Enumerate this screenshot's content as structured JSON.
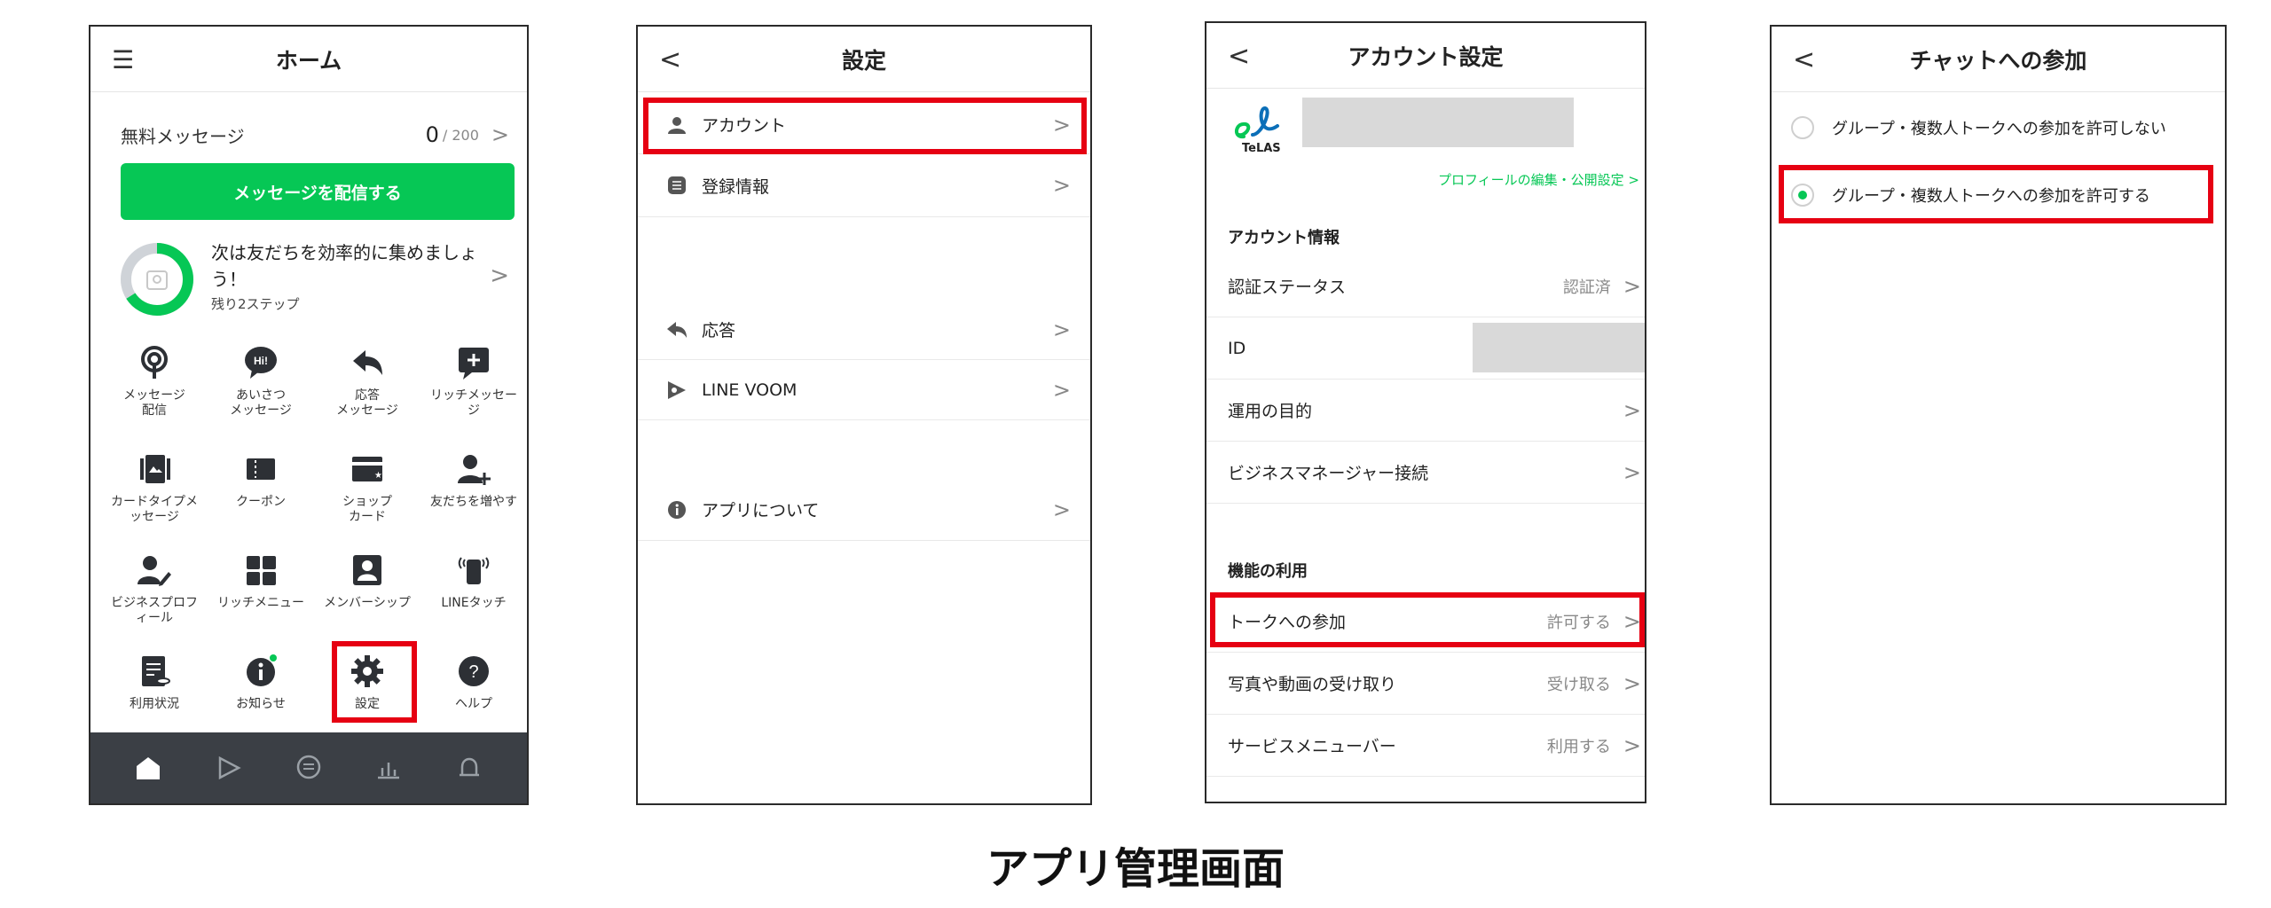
{
  "screens": {
    "home": {
      "title": "ホーム",
      "free_label": "無料メッセージ",
      "free_count": "0",
      "free_total": "/ 200",
      "broadcast_button": "メッセージを配信する",
      "progress_text": "次は友だちを効率的に集めましょう！",
      "progress_sub": "残り2ステップ",
      "tiles": [
        {
          "label": "メッセージ\n配信",
          "icon": "broadcast-icon"
        },
        {
          "label": "あいさつ\nメッセージ",
          "icon": "greeting-icon"
        },
        {
          "label": "応答\nメッセージ",
          "icon": "reply-icon"
        },
        {
          "label": "リッチメッセー\nジ",
          "icon": "rich-message-icon"
        },
        {
          "label": "カードタイプメ\nッセージ",
          "icon": "card-message-icon"
        },
        {
          "label": "クーポン",
          "icon": "coupon-icon"
        },
        {
          "label": "ショップ\nカード",
          "icon": "shop-card-icon"
        },
        {
          "label": "友だちを増やす",
          "icon": "add-friend-icon"
        },
        {
          "label": "ビジネスプロフ\nィール",
          "icon": "business-profile-icon"
        },
        {
          "label": "リッチメニュー",
          "icon": "rich-menu-icon"
        },
        {
          "label": "メンバーシップ",
          "icon": "membership-icon"
        },
        {
          "label": "LINEタッチ",
          "icon": "line-touch-icon"
        },
        {
          "label": "利用状況",
          "icon": "usage-icon"
        },
        {
          "label": "お知らせ",
          "icon": "info-icon"
        },
        {
          "label": "設定",
          "icon": "gear-icon"
        },
        {
          "label": "ヘルプ",
          "icon": "help-icon"
        }
      ]
    },
    "settings": {
      "title": "設定",
      "items": [
        {
          "label": "アカウント",
          "icon": "person-icon"
        },
        {
          "label": "登録情報",
          "icon": "registration-icon"
        },
        {
          "label": "応答",
          "icon": "reply-icon"
        },
        {
          "label": "LINE VOOM",
          "icon": "voom-icon"
        },
        {
          "label": "アプリについて",
          "icon": "info-icon"
        }
      ]
    },
    "account": {
      "title": "アカウント設定",
      "logo_text": "TeLAS",
      "profile_link": "プロフィールの編集・公開設定 >",
      "section_info": "アカウント情報",
      "section_features": "機能の利用",
      "rows": [
        {
          "label": "認証ステータス",
          "value": "認証済"
        },
        {
          "label": "ID",
          "value": ""
        },
        {
          "label": "運用の目的",
          "value": ""
        },
        {
          "label": "ビジネスマネージャー接続",
          "value": ""
        },
        {
          "label": "トークへの参加",
          "value": "許可する"
        },
        {
          "label": "写真や動画の受け取り",
          "value": "受け取る"
        },
        {
          "label": "サービスメニューバー",
          "value": "利用する"
        }
      ]
    },
    "chat": {
      "title": "チャットへの参加",
      "options": [
        {
          "label": "グループ・複数人トークへの参加を許可しない",
          "selected": false
        },
        {
          "label": "グループ・複数人トークへの参加を許可する",
          "selected": true
        }
      ]
    }
  },
  "caption": "アプリ管理画面",
  "colors": {
    "green": "#06c755",
    "highlight": "#e60012",
    "nav_bg": "#3b3f45",
    "redacted": "#d9d9d9"
  }
}
